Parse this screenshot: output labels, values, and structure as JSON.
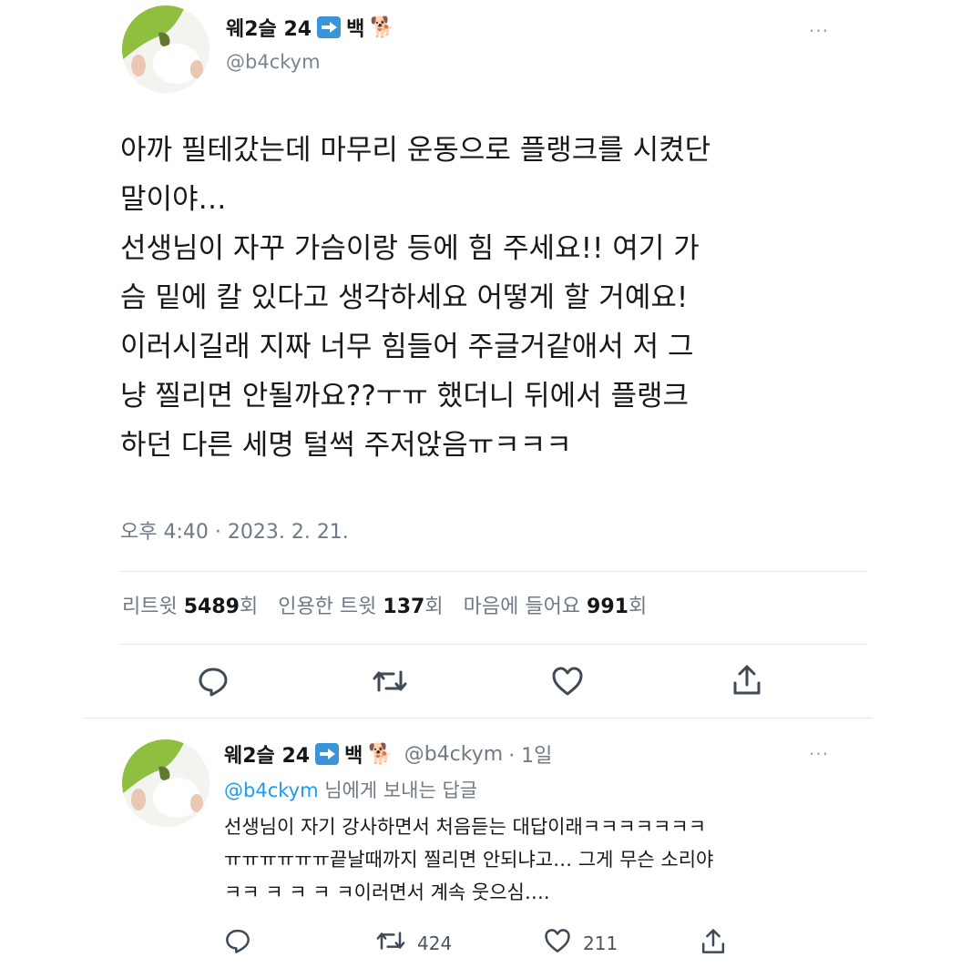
{
  "tweet": {
    "name": "웨2슬 24",
    "name_suffix": "백",
    "handle": "@b4ckym",
    "more": "···",
    "text": "아까 필테갔는데 마무리 운동으로 플랭크를 시켰단\n말이야…\n선생님이 자꾸 가슴이랑 등에 힘 주세요!! 여기 가\n슴 밑에 칼 있다고 생각하세요 어떻게 할 거예요!\n이러시길래 지짜 너무 힘들어 주글거같애서 저 그\n냥 찔리면 안될까요??ㅜㅠ 했더니 뒤에서 플랭크\n하던 다른 세명 털썩 주저앉음ㅠㅋㅋㅋ",
    "timestamp": "오후 4:40 · 2023. 2. 21.",
    "stats": {
      "retweets_label": "리트윗",
      "retweets": "5489",
      "retweets_unit": "회",
      "quotes_label": "인용한 트윗",
      "quotes": "137",
      "quotes_unit": "회",
      "likes_label": "마음에 들어요",
      "likes": "991",
      "likes_unit": "회"
    }
  },
  "reply": {
    "name": "웨2슬 24",
    "name_suffix": "백",
    "handle": "@b4ckym",
    "time": "· 1일",
    "more": "···",
    "replying_mention": "@b4ckym",
    "replying_text": " 님에게 보내는 답글",
    "text": "선생님이 자기 강사하면서 처음듣는 대답이래ㅋㅋㅋㅋㅋㅋㅋ\nㅠㅠㅠㅠㅠㅠ끝날때까지 찔리면 안되냐고… 그게 무슨 소리야\nㅋㅋ ㅋ ㅋ ㅋ ㅋ이러면서 계속 웃으심….",
    "retweet_count": "424",
    "like_count": "211"
  },
  "icons": {
    "reply": "comment-icon",
    "retweet": "retweet-icon",
    "like": "heart-icon",
    "share": "share-icon"
  }
}
